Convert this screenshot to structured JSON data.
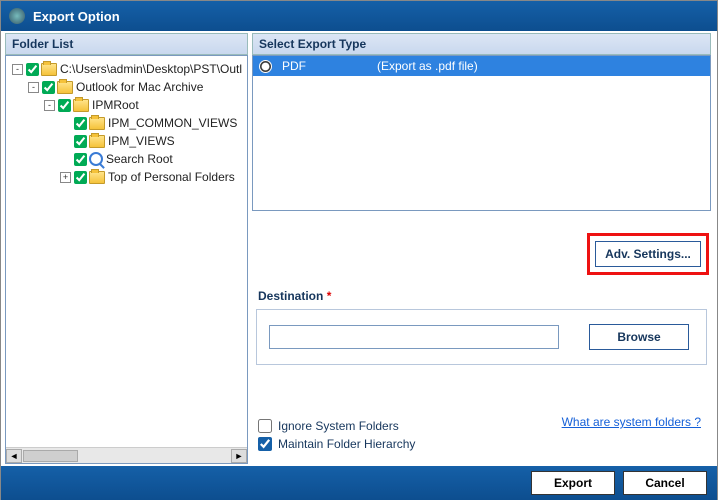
{
  "window": {
    "title": "Export Option"
  },
  "left_panel": {
    "header": "Folder List"
  },
  "tree": {
    "root": "C:\\Users\\admin\\Desktop\\PST\\Outl",
    "n1": "Outlook for Mac Archive",
    "n2": "IPMRoot",
    "n3": "IPM_COMMON_VIEWS",
    "n4": "IPM_VIEWS",
    "n5": "Search Root",
    "n6": "Top of Personal Folders"
  },
  "right_panel": {
    "header": "Select Export Type",
    "pdf_label": "PDF",
    "pdf_desc": "(Export as .pdf file)",
    "adv_settings": "Adv. Settings...",
    "destination_label": "Destination",
    "destination_value": "",
    "browse": "Browse",
    "ignore_system": "Ignore System Folders",
    "maintain_hierarchy": "Maintain Folder Hierarchy",
    "sys_link": "What are system folders ?"
  },
  "footer": {
    "export": "Export",
    "cancel": "Cancel"
  }
}
